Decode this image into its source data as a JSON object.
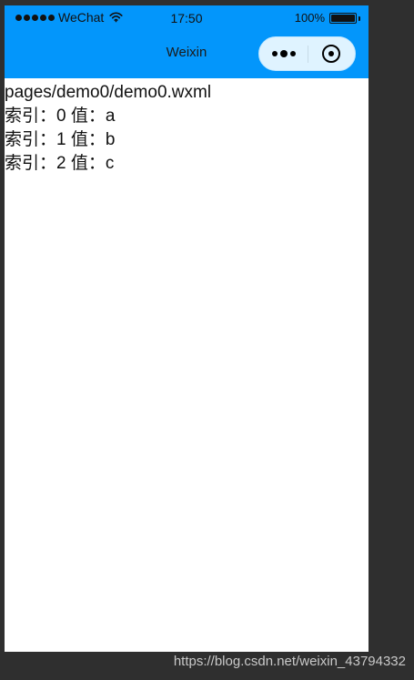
{
  "status_bar": {
    "carrier": "WeChat",
    "time": "17:50",
    "battery_percent": "100%"
  },
  "navbar": {
    "title": "Weixin"
  },
  "content": {
    "path": "pages/demo0/demo0.wxml",
    "items": [
      "索引：0 值：a",
      "索引：1 值：b",
      "索引：2 值：c"
    ]
  },
  "watermark": "https://blog.csdn.net/weixin_43794332",
  "icons": {
    "wifi": "wifi-icon",
    "battery": "battery-icon",
    "menu": "more-dots-icon",
    "close": "target-icon"
  }
}
